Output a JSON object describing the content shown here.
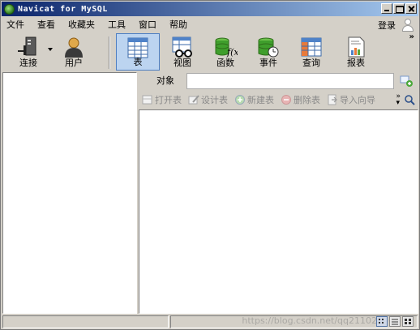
{
  "window": {
    "title": "Navicat for MySQL"
  },
  "menu": {
    "items": [
      "文件",
      "查看",
      "收藏夹",
      "工具",
      "窗口",
      "帮助"
    ],
    "login": "登录"
  },
  "toolbar": {
    "connect": "连接",
    "user": "用户",
    "table": "表",
    "view": "视图",
    "function": "函数",
    "event": "事件",
    "query": "查询",
    "report": "报表",
    "more": "»"
  },
  "object_tab": {
    "label": "对象"
  },
  "object_toolbar": {
    "open_table": "打开表",
    "design_table": "设计表",
    "new_table": "新建表",
    "delete_table": "删除表",
    "import_wizard": "导入向导"
  },
  "status": {
    "watermark": "https://blog.csdn.net/qq21102936"
  },
  "colors": {
    "titlebar_start": "#0a246a",
    "titlebar_end": "#a6caf0",
    "active_tool": "#bcd4f0"
  }
}
